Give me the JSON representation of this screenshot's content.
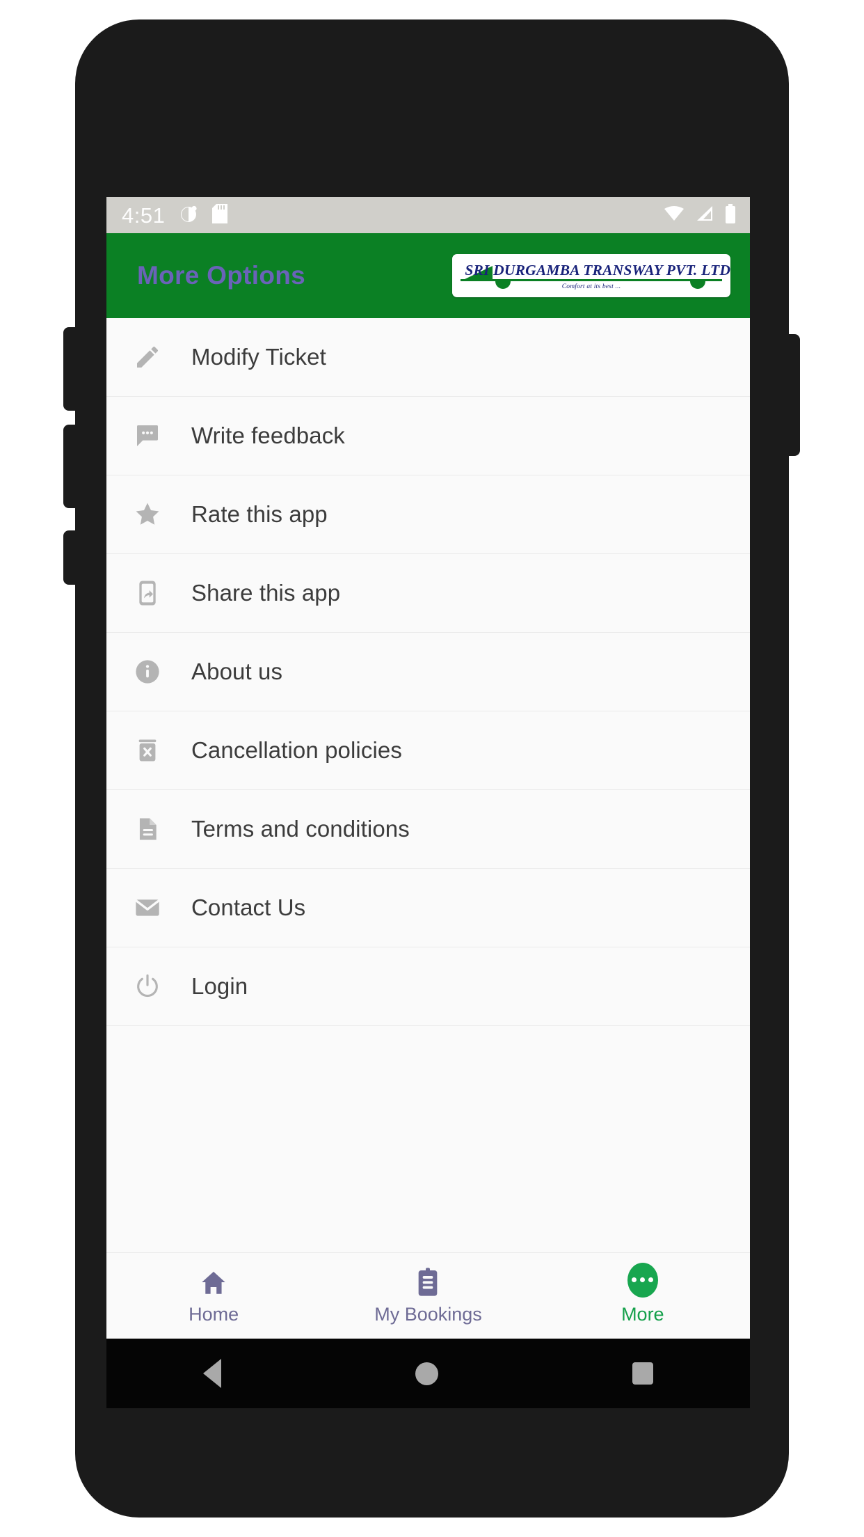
{
  "device": {
    "status_bar": {
      "time": "4:51",
      "left_icons": [
        "notification-circle-icon",
        "sd-card-icon"
      ],
      "right_icons": [
        "wifi-icon",
        "cellular-signal-icon",
        "battery-icon"
      ]
    },
    "system_nav": {
      "back_label": "Back",
      "home_label": "Home",
      "recents_label": "Recents"
    }
  },
  "app_bar": {
    "title": "More Options",
    "logo": {
      "company_name": "SRI DURGAMBA TRANSWAY PVT. LTD.",
      "tagline": "Comfort at its best ...",
      "brand_green": "#0b8024",
      "brand_navy": "#19237a"
    },
    "background_color": "#0b8024",
    "title_color": "#6a63b8"
  },
  "menu": {
    "items": [
      {
        "label": "Modify Ticket",
        "icon": "pencil-icon"
      },
      {
        "label": "Write feedback",
        "icon": "chat-bubble-icon"
      },
      {
        "label": "Rate this app",
        "icon": "star-icon"
      },
      {
        "label": "Share this app",
        "icon": "share-phone-icon"
      },
      {
        "label": "About us",
        "icon": "info-circle-icon"
      },
      {
        "label": "Cancellation policies",
        "icon": "delete-ticket-icon"
      },
      {
        "label": "Terms and conditions",
        "icon": "document-icon"
      },
      {
        "label": "Contact Us",
        "icon": "envelope-icon"
      },
      {
        "label": "Login",
        "icon": "power-icon"
      }
    ]
  },
  "bottom_nav": {
    "active_color": "#14a04a",
    "inactive_color": "#6e6b95",
    "tabs": [
      {
        "label": "Home",
        "icon": "home-icon",
        "active": false
      },
      {
        "label": "My Bookings",
        "icon": "clipboard-icon",
        "active": false
      },
      {
        "label": "More",
        "icon": "more-dots-icon",
        "active": true
      }
    ]
  }
}
